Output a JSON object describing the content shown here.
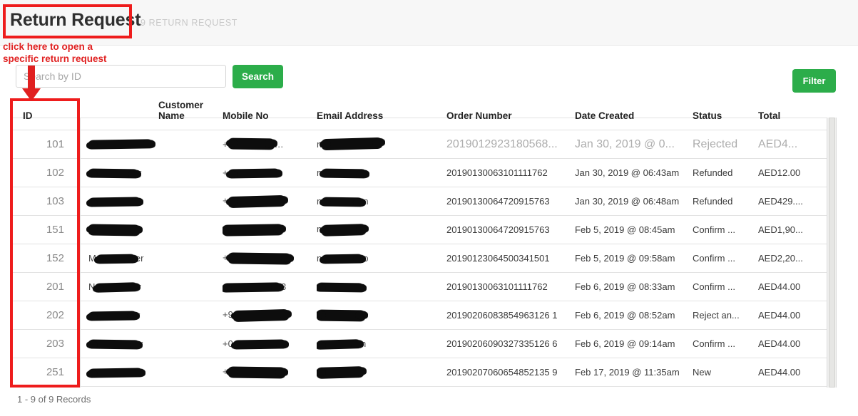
{
  "header": {
    "title": "Return Request",
    "subtitle": "9 RETURN REQUEST"
  },
  "annotations": {
    "note": "click here to open a\nspecific return request",
    "color": "#e02020"
  },
  "toolbar": {
    "search_placeholder": "Search by ID",
    "search_value": "",
    "search_label": "Search",
    "filter_label": "Filter",
    "accent_color": "#2cad4a"
  },
  "table": {
    "columns": [
      "ID",
      "Customer Name",
      "Mobile No",
      "Email Address",
      "Order Number",
      "Date Created",
      "Status",
      "Total"
    ],
    "rows": [
      {
        "id": "101",
        "customer_name": "",
        "mobile_no": "",
        "email": "",
        "order_number": "2019012923180568...",
        "date_created": "Jan 30, 2019 @ 0...",
        "status": "Rejected",
        "total": "AED4..."
      },
      {
        "id": "102",
        "customer_name": "",
        "mobile_no": "",
        "email": "",
        "order_number": "20190130063101111762",
        "date_created": "Jan 30, 2019 @ 06:43am",
        "status": "Refunded",
        "total": "AED12.00"
      },
      {
        "id": "103",
        "customer_name": "",
        "mobile_no": "",
        "email": "",
        "order_number": "20190130064720915763",
        "date_created": "Jan 30, 2019 @ 06:48am",
        "status": "Refunded",
        "total": "AED429...."
      },
      {
        "id": "151",
        "customer_name": "",
        "mobile_no": "",
        "email": "",
        "order_number": "20190130064720915763",
        "date_created": "Feb 5, 2019 @ 08:45am",
        "status": "Confirm ...",
        "total": "AED1,90..."
      },
      {
        "id": "152",
        "customer_name": "",
        "mobile_no": "",
        "email": "",
        "order_number": "20190123064500341501",
        "date_created": "Feb 5, 2019 @ 09:58am",
        "status": "Confirm ...",
        "total": "AED2,20..."
      },
      {
        "id": "201",
        "customer_name": "",
        "mobile_no": "",
        "email": "",
        "order_number": "20190130063101111762",
        "date_created": "Feb 6, 2019 @ 08:33am",
        "status": "Confirm ...",
        "total": "AED44.00"
      },
      {
        "id": "202",
        "customer_name": "",
        "mobile_no": "",
        "email": "",
        "order_number": "20190206083854963126 1",
        "date_created": "Feb 6, 2019 @ 08:52am",
        "status": "Reject an...",
        "total": "AED44.00"
      },
      {
        "id": "203",
        "customer_name": "",
        "mobile_no": "",
        "email": "",
        "order_number": "20190206090327335126 6",
        "date_created": "Feb 6, 2019 @ 09:14am",
        "status": "Confirm ...",
        "total": "AED44.00"
      },
      {
        "id": "251",
        "customer_name": "",
        "mobile_no": "",
        "email": "",
        "order_number": "20190207060654852135 9",
        "date_created": "Feb 17, 2019 @ 11:35am",
        "status": "New",
        "total": "AED44.00"
      }
    ]
  },
  "footer": {
    "records": "1 - 9 of 9 Records"
  }
}
